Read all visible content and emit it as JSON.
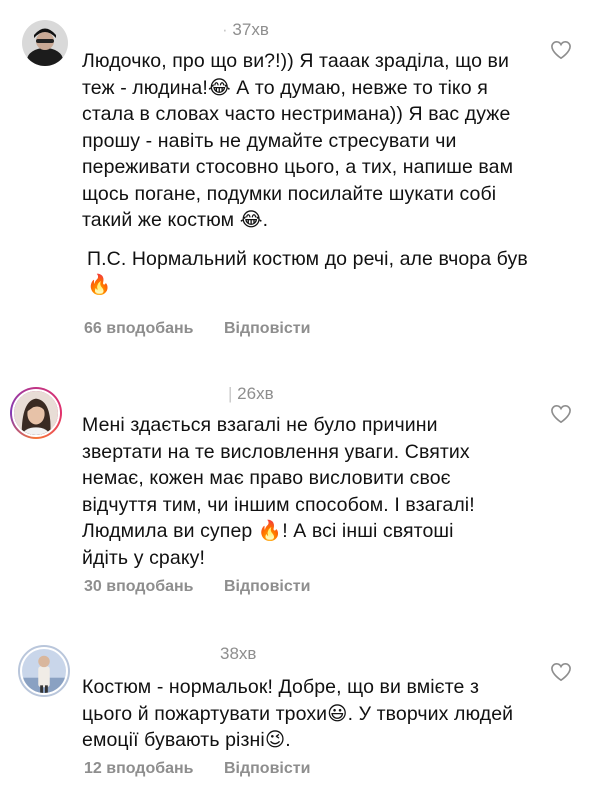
{
  "comments": [
    {
      "username": "",
      "time": "37хв",
      "paragraphs": [
        "Людочко, про що ви?!)) Я тааак зраділа, що ви теж - людина!😂 А то думаю, невже то тіко я стала в словах часто нестримана)) Я вас дуже прошу - навіть не думайте стресувати чи переживати стосовно цього, а  тих, напише вам щось погане, подумки посилайте шукати собі такий же костюм 😂.",
        "П.С. Нормальний костюм до речі, але вчора був 🔥"
      ],
      "likes": "66 вподобань",
      "reply": "Відповісти",
      "avatar_icon": "person-with-cap-avatar"
    },
    {
      "username": "",
      "time": "26хв",
      "paragraphs": [
        "Мені здається взагалі не було причини звертати на те висловлення уваги. Святих немає, кожен має право висловити своє відчуття тим, чи іншим способом. І взагалі! Людмила ви супер 🔥! А всі інші святоші йдіть у сраку!"
      ],
      "likes": "30 вподобань",
      "reply": "Відповісти",
      "avatar_icon": "woman-portrait-avatar"
    },
    {
      "username": "",
      "time": "38хв",
      "paragraphs": [
        "Костюм - нормальок! Добре, що ви вмієте з цього й пожартувати трохи😃. У творчих людей емоції бувають різні😉."
      ],
      "likes": "12 вподобань",
      "reply": "Відповісти",
      "avatar_icon": "person-on-stage-avatar"
    }
  ],
  "colors": {
    "text": "#111111",
    "meta": "#8e8e8e",
    "ring_blue": "#b9c6db"
  }
}
